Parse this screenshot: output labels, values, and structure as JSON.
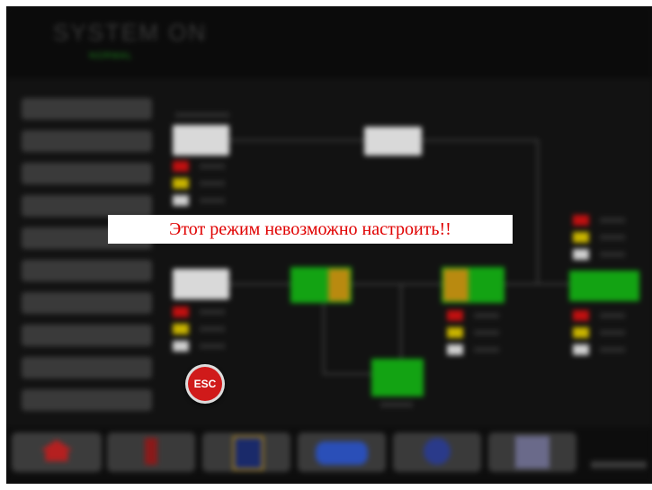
{
  "header": {
    "title": "SYSTEM ON",
    "subtitle": "NORMAL"
  },
  "popup": {
    "message": "Этот режим невозможно настроить!!"
  },
  "esc_button": {
    "label": "ESC"
  },
  "colors": {
    "background": "#101010",
    "popup_text": "#e00000",
    "esc_red": "#d01a1a",
    "status_green": "#13a313"
  },
  "icons": [
    "home-icon",
    "esc-icon"
  ]
}
